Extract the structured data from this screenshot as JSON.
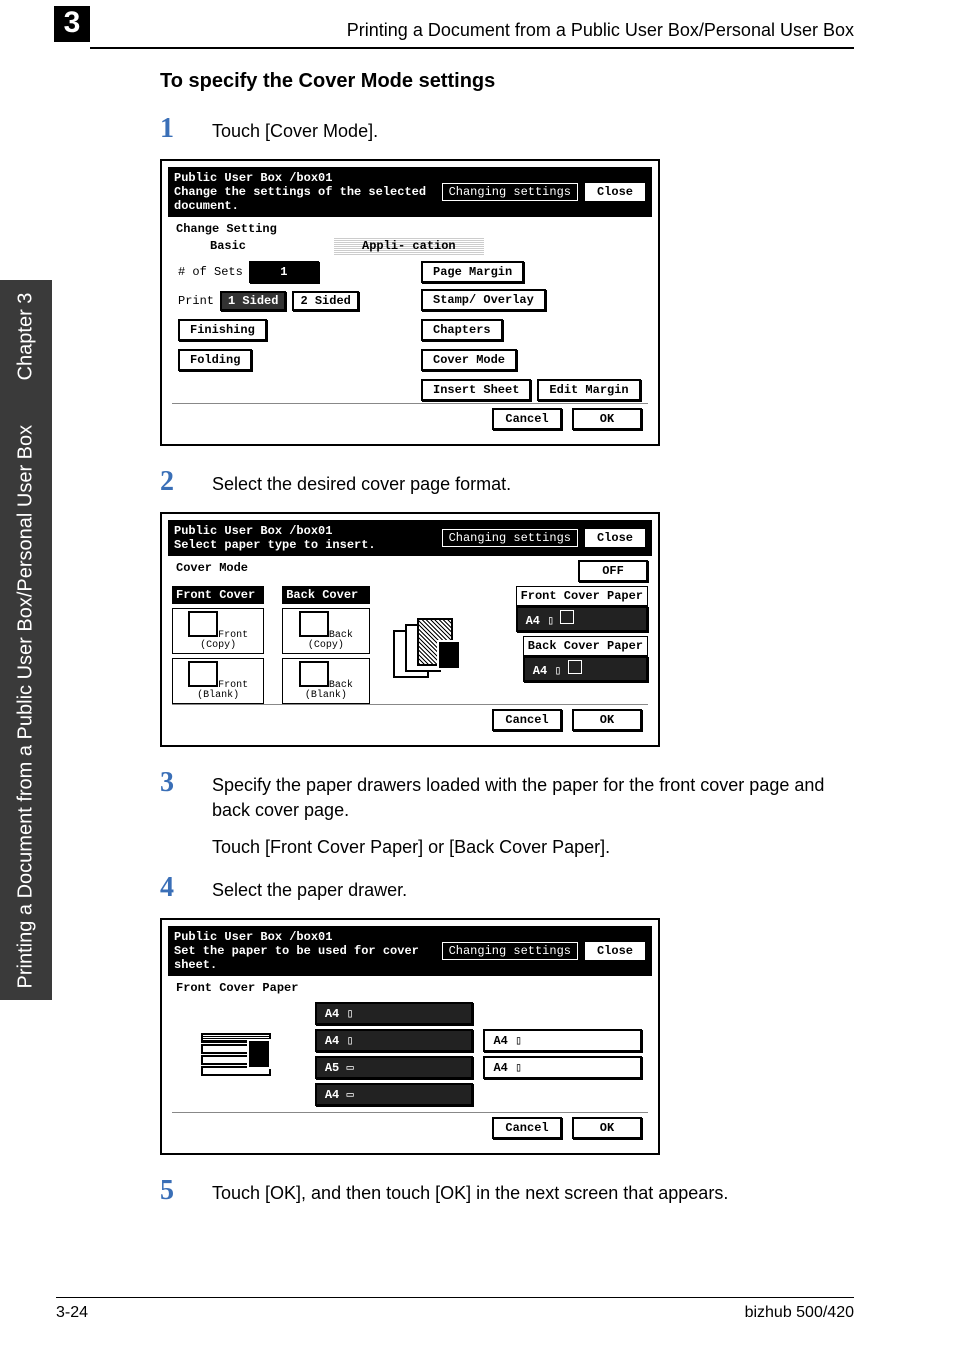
{
  "header": {
    "chapter_number_large": "3",
    "running_head": "Printing a Document from a Public User Box/Personal User Box"
  },
  "sidebar": {
    "book_section": "Printing a Document from a Public User Box/Personal User Box",
    "chapter_label": "Chapter 3"
  },
  "section": {
    "title": "To specify the Cover Mode settings"
  },
  "steps": {
    "s1": {
      "num": "1",
      "text": "Touch [Cover Mode]."
    },
    "s2": {
      "num": "2",
      "text": "Select the desired cover page format."
    },
    "s3": {
      "num": "3",
      "text": "Specify the paper drawers loaded with the paper for the front cover page and back cover page.",
      "sub": "Touch [Front Cover Paper] or [Back Cover Paper]."
    },
    "s4": {
      "num": "4",
      "text": "Select the paper drawer."
    },
    "s5": {
      "num": "5",
      "text": "Touch [OK], and then touch [OK] in the next screen that appears."
    }
  },
  "panel1": {
    "path_line1a": "Public",
    "path_line1b": "User Box",
    "path_box": "/box01",
    "status": "Changing settings",
    "close": "Close",
    "subtitle": "Change the settings of the selected document.",
    "section_label": "Change Setting",
    "tab_basic": "Basic",
    "tab_appli": "Appli- cation",
    "sets_lbl": "# of Sets",
    "sets_val": "1",
    "print_lbl": "Print",
    "sided1": "1 Sided",
    "sided2": "2 Sided",
    "finishing": "Finishing",
    "folding": "Folding",
    "page_margin": "Page Margin",
    "chapters": "Chapters",
    "cover_mode": "Cover Mode",
    "insert_sheet": "Insert Sheet",
    "stamp": "Stamp/ Overlay",
    "edit_margin": "Edit Margin",
    "cancel": "Cancel",
    "ok": "OK"
  },
  "panel2": {
    "path_line1a": "Public",
    "path_line1b": "User Box",
    "path_box": "/box01",
    "status": "Changing settings",
    "close": "Close",
    "subtitle": "Select paper type to insert.",
    "section_label": "Cover Mode",
    "off": "OFF",
    "front_cover": "Front Cover",
    "back_cover": "Back Cover",
    "front_copy": "Front (Copy)",
    "back_copy": "Back (Copy)",
    "front_blank": "Front (Blank)",
    "back_blank": "Back (Blank)",
    "front_cover_paper": "Front Cover Paper",
    "back_cover_paper": "Back Cover Paper",
    "tray1": "A4 ▯",
    "tray2": "A4 ▯",
    "cancel": "Cancel",
    "ok": "OK"
  },
  "panel3": {
    "path_line1a": "Public",
    "path_line1b": "User Box",
    "path_box": "/box01",
    "status": "Changing settings",
    "close": "Close",
    "subtitle": "Set the paper to be used for cover sheet.",
    "section_label": "Front Cover Paper",
    "t1": "A4 ▯",
    "t2": "A4 ▯",
    "t3": "A5 ▭",
    "t4": "A4 ▭",
    "t5": "A4 ▯",
    "t6": "A4 ▯",
    "cancel": "Cancel",
    "ok": "OK"
  },
  "footer": {
    "page": "3-24",
    "product": "bizhub 500/420"
  }
}
